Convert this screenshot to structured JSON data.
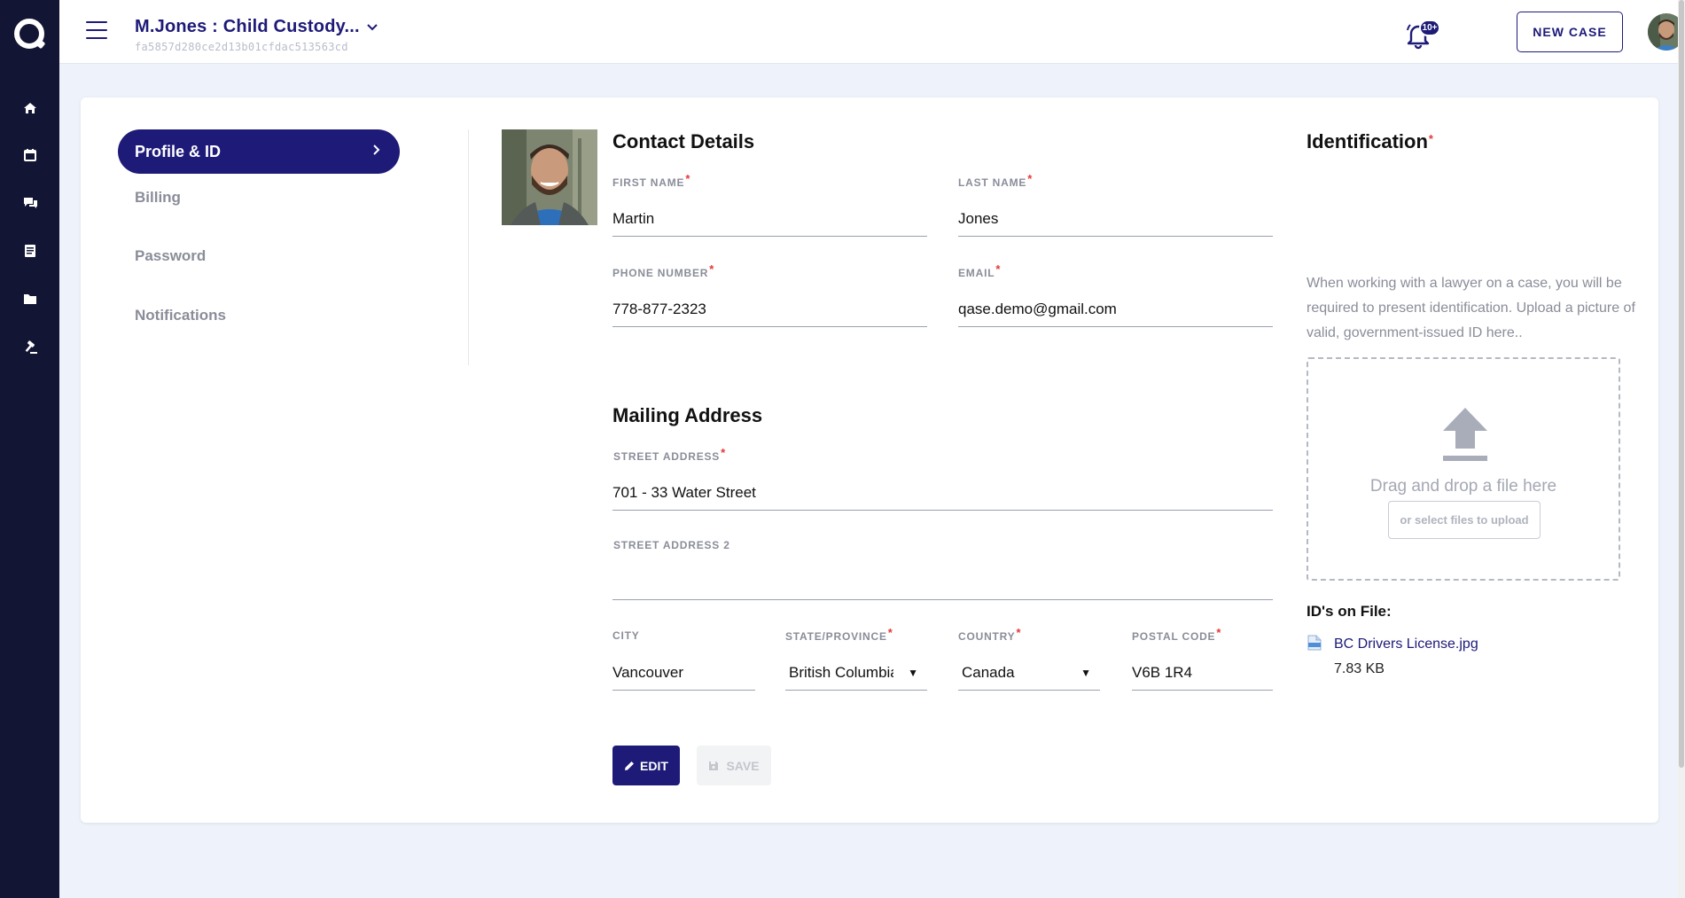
{
  "header": {
    "case_title": "M.Jones : Child Custody...",
    "case_id": "fa5857d280ce2d13b01cfdac513563cd",
    "notification_badge": "10+",
    "new_case_label": "NEW CASE"
  },
  "rail": {
    "icons": [
      "home-icon",
      "calendar-icon",
      "chat-icon",
      "document-icon",
      "folder-icon",
      "gavel-icon"
    ]
  },
  "menu": {
    "active": "Profile & ID",
    "items": [
      "Billing",
      "Password",
      "Notifications"
    ]
  },
  "contact": {
    "title": "Contact Details",
    "first_name_label": "FIRST NAME",
    "first_name": "Martin",
    "last_name_label": "LAST NAME",
    "last_name": "Jones",
    "phone_label": "PHONE NUMBER",
    "phone": "778-877-2323",
    "email_label": "EMAIL",
    "email": "qase.demo@gmail.com"
  },
  "mailing": {
    "title": "Mailing Address",
    "street_label": "STREET ADDRESS",
    "street": "701 - 33 Water Street",
    "street2_label": "STREET ADDRESS 2",
    "street2": "",
    "city_label": "CITY",
    "city": "Vancouver",
    "state_label": "STATE/PROVINCE",
    "state": "British Columbia",
    "country_label": "COUNTRY",
    "country": "Canada",
    "postal_label": "POSTAL CODE",
    "postal": "V6B 1R4"
  },
  "actions": {
    "edit_label": "EDIT",
    "save_label": "SAVE"
  },
  "identification": {
    "title": "Identification",
    "description": "When working with a lawyer on a case, you will be required to present identification. Upload a picture of valid, government-issued ID here..",
    "drop_text": "Drag and drop a file here",
    "select_button": "or select files to upload",
    "ids_title": "ID's on File:",
    "file_name": "BC Drivers License.jpg",
    "file_size": "7.83 KB"
  },
  "colors": {
    "primary": "#1e1a78",
    "rail": "#131534",
    "required": "#e53935"
  }
}
